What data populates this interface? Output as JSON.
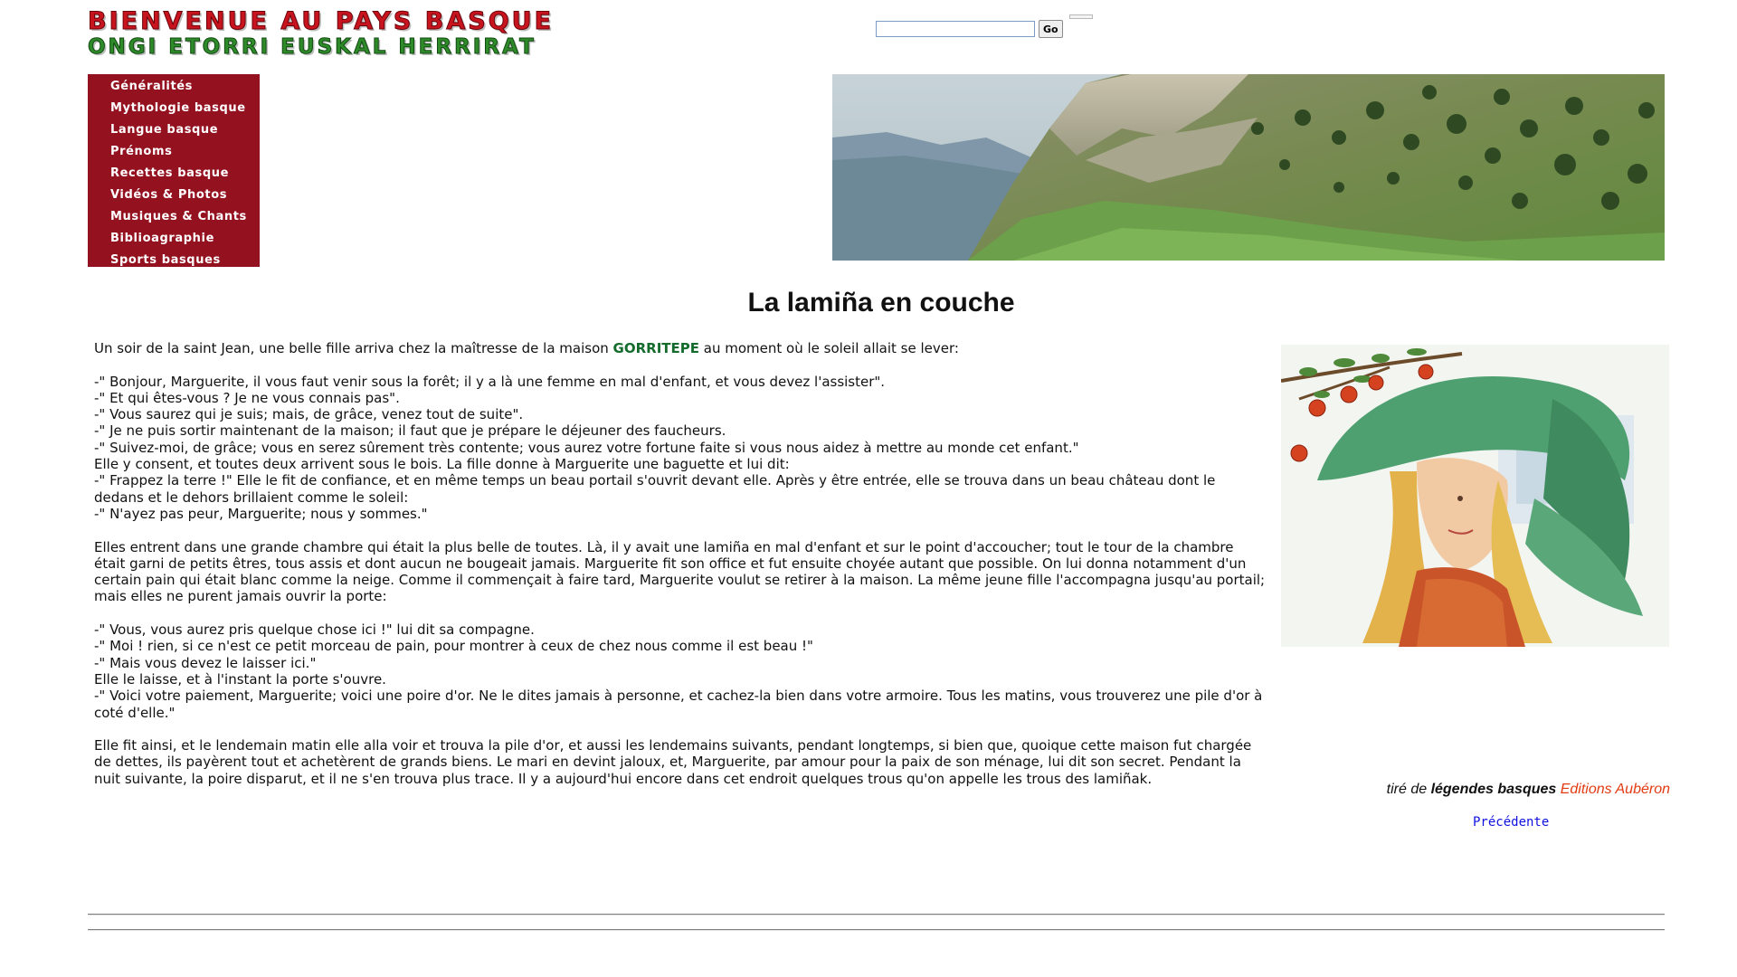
{
  "header": {
    "logo_line_1": "BIENVENUE AU PAYS BASQUE",
    "logo_line_2": "ONGI ETORRI EUSKAL HERRIRAT"
  },
  "search": {
    "value": "",
    "button_label": "Go"
  },
  "menu": {
    "items": [
      {
        "label": "Généralités"
      },
      {
        "label": "Mythologie basque"
      },
      {
        "label": "Langue basque"
      },
      {
        "label": "Prénoms"
      },
      {
        "label": "Recettes basque"
      },
      {
        "label": "Vidéos & Photos"
      },
      {
        "label": "Musiques & Chants"
      },
      {
        "label": "Biblioagraphie"
      },
      {
        "label": "Sports basques"
      }
    ]
  },
  "article": {
    "title": "La lamiña en couche",
    "intro_before": "Un soir de la saint Jean, une belle fille arriva chez la maîtresse de la maison ",
    "house_name": "GORRITEPE",
    "intro_after": " au moment où le soleil allait se lever:",
    "block1": [
      "-\" Bonjour, Marguerite, il vous faut venir sous la forêt; il y a là une femme en mal d'enfant, et vous devez l'assister\".",
      "-\" Et qui êtes-vous ? Je ne vous connais pas\".",
      "-\" Vous saurez qui je suis; mais, de grâce, venez tout de suite\".",
      "-\" Je ne puis sortir maintenant de la maison; il faut que je prépare le déjeuner des faucheurs.",
      "-\" Suivez-moi, de grâce; vous en serez sûrement très contente; vous aurez votre fortune faite si vous nous aidez à mettre au monde cet enfant.\"",
      "Elle y consent, et toutes deux arrivent sous le bois. La fille donne à Marguerite une baguette et lui dit:",
      "-\" Frappez la terre !\" Elle le fit de confiance, et en même temps un beau portail s'ouvrit devant elle. Après y être entrée, elle se trouva dans un beau château dont le dedans et le dehors brillaient comme le soleil:",
      "-\" N'ayez pas peur, Marguerite; nous y sommes.\""
    ],
    "paragraph2": "Elles entrent dans une grande chambre qui était la plus belle de toutes. Là, il y avait une lamiña en mal d'enfant et sur le point d'accoucher; tout le tour de la chambre était garni de petits êtres, tous assis et dont aucun ne bougeait jamais. Marguerite fit son office et fut ensuite choyée autant que possible. On lui donna notamment d'un certain pain qui était blanc comme la neige. Comme il commençait à faire tard, Marguerite voulut se retirer à la maison. La même jeune fille l'accompagna jusqu'au portail; mais elles ne purent jamais ouvrir la porte:",
    "block3": [
      "-\" Vous, vous aurez pris quelque chose ici !\" lui dit sa compagne.",
      "-\" Moi ! rien, si ce n'est ce petit morceau de pain, pour montrer à ceux de chez nous comme il est beau !\"",
      "-\" Mais vous devez le laisser ici.\"",
      "Elle le laisse, et à l'instant la porte s'ouvre.",
      "-\" Voici votre paiement, Marguerite; voici une poire d'or. Ne le dites jamais à personne, et cachez-la bien dans votre armoire. Tous les matins, vous trouverez une pile d'or à coté d'elle.\""
    ],
    "paragraph4": "Elle fit ainsi, et le lendemain matin elle alla voir et trouva la pile d'or, et aussi les lendemains suivants, pendant longtemps, si bien que, quoique cette maison fut chargée de dettes, ils payèrent tout et achetèrent de grands biens. Le mari en devint jaloux, et, Marguerite, par amour pour la paix de son ménage, lui dit son secret. Pendant la nuit suivante, la poire disparut, et il ne s'en trouva plus trace. Il y a aujourd'hui encore dans cet endroit quelques trous qu'on appelle les trous des lamiñak."
  },
  "source": {
    "prefix": "tiré de",
    "book": "légendes basques",
    "publisher": "Editions Aubéron"
  },
  "nav": {
    "previous_label": "Précédente"
  },
  "colors": {
    "menu_background": "#94111f",
    "logo_red": "#c8141e",
    "logo_green": "#2f8a2a",
    "house_name": "#136b2c",
    "publisher": "#e23b12",
    "link": "#1010e0"
  },
  "icons": {
    "banner": "mountain-landscape-photo",
    "illustration": "lamina-woman-with-green-veil-and-apples"
  }
}
